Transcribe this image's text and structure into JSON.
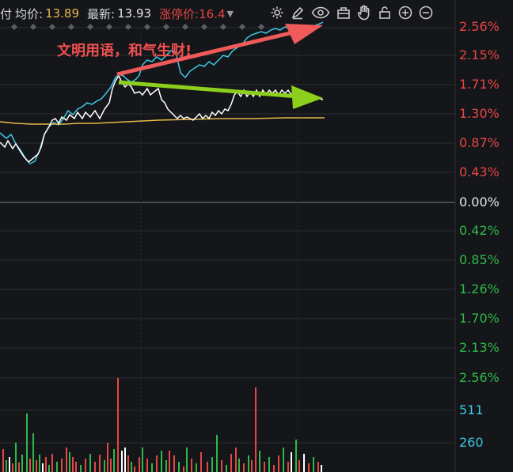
{
  "toolbar": {
    "left_fragment": "付",
    "avg_label": "均价:",
    "avg_value": "13.89",
    "latest_label": "最新:",
    "latest_value": "13.93",
    "limit_label": "涨停价:16.4",
    "icons": [
      "gear-icon",
      "pen-icon",
      "eye-icon",
      "briefcase-icon",
      "hand-icon",
      "lock-icon",
      "zoom-in-icon",
      "zoom-out-icon"
    ]
  },
  "annotation": "文明用语，和气生财!",
  "axis": {
    "upper": [
      "2.56%",
      "2.15%",
      "1.71%",
      "1.30%",
      "0.87%",
      "0.43%"
    ],
    "zero": "0.00%",
    "lower": [
      "0.42%",
      "0.85%",
      "1.26%",
      "1.70%",
      "2.13%",
      "2.56%"
    ],
    "volume": [
      "511",
      "260"
    ]
  },
  "colors": {
    "up": "#e64646",
    "down": "#2fb84a",
    "price_line": "#ffffff",
    "avg_line": "#e8b84a",
    "benchmark_line": "#3ec7e6",
    "arrow_red": "#f05a5a",
    "arrow_green": "#8ccf1c"
  }
}
